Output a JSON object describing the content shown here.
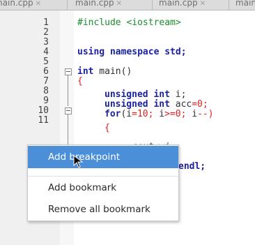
{
  "tabs": [
    "main.cpp",
    "main.cpp",
    "main.cpp",
    "main."
  ],
  "tab_close": "✕",
  "line_numbers": [
    "1",
    "2",
    "3",
    "4",
    "5",
    "6",
    "7",
    "8",
    "9",
    "10",
    "11"
  ],
  "code": {
    "l1": "#include <iostream>",
    "l3_kw1": "using namespace",
    "l3_id": "std;",
    "l5_kw": "int",
    "l5_rest": " main()",
    "l6": "{",
    "l7_kw": "unsigned int",
    "l7_rest": " i;",
    "l8_kw": "unsigned int",
    "l8_rest": " acc",
    "l8_op": "=0;",
    "l9_kw": "for",
    "l9_rest": "(i",
    "l9_a": "=10;",
    "l9_b": " i",
    "l9_c": ">=0;",
    "l9_d": " i",
    "l9_e": "--)",
    "l10": "{",
    "l11": "cout<<i;",
    "l13_kw": "endl;"
  },
  "context_menu": {
    "add_breakpoint": "Add breakpoint",
    "add_bookmark": "Add bookmark",
    "remove_all_bookmark": "Remove all bookmark"
  },
  "colors": {
    "keyword": "#1a22a0",
    "preprocessor": "#1a8d2e",
    "number": "#e12020",
    "menu_highlight": "#4b8fd8"
  }
}
